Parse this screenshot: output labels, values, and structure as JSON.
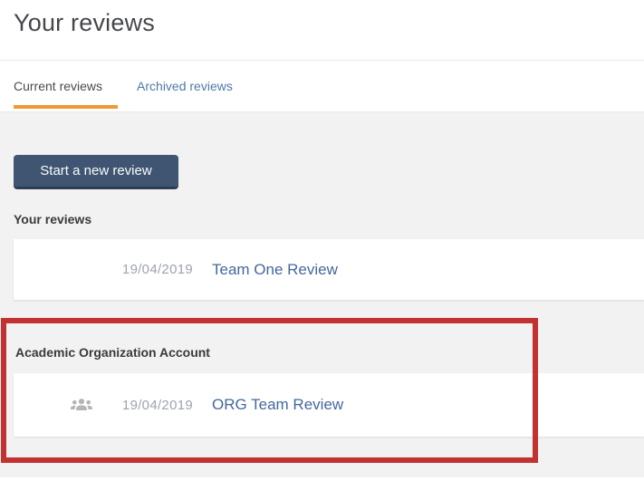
{
  "page": {
    "title": "Your reviews"
  },
  "tabs": {
    "current": "Current reviews",
    "archived": "Archived reviews"
  },
  "actions": {
    "start_review": "Start a new review"
  },
  "sections": [
    {
      "heading": "Your reviews",
      "rows": [
        {
          "icon": null,
          "date": "19/04/2019",
          "title": "Team One Review"
        }
      ]
    },
    {
      "heading": "Academic Organization Account",
      "rows": [
        {
          "icon": "group-icon",
          "date": "19/04/2019",
          "title": "ORG Team Review"
        }
      ]
    }
  ],
  "annotation": {
    "type": "highlight-box",
    "color": "#c13231"
  },
  "colors": {
    "tab_accent_orange": "#f0982e",
    "link_blue": "#44689e",
    "tab_link_blue": "#4f79ab",
    "button_bg": "#3f5571",
    "panel_gray": "#f2f2f2",
    "date_gray": "#9ea4ac",
    "highlight_red": "#c13231"
  }
}
